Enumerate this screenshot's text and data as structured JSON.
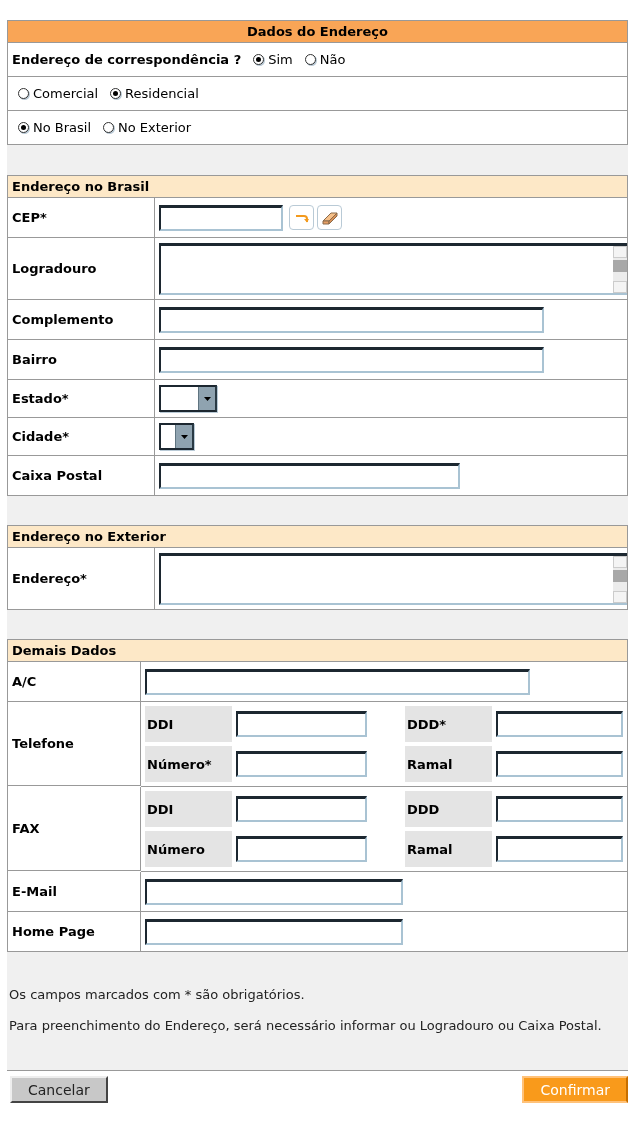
{
  "title": "Dados do Endereço",
  "correspondence": {
    "label": "Endereço de correspondência ?",
    "options": [
      {
        "label": "Sim",
        "selected": true
      },
      {
        "label": "Não",
        "selected": false
      }
    ]
  },
  "address_type": {
    "options": [
      {
        "label": "Comercial",
        "selected": false
      },
      {
        "label": "Residencial",
        "selected": true
      }
    ]
  },
  "location": {
    "options": [
      {
        "label": "No Brasil",
        "selected": true
      },
      {
        "label": "No Exterior",
        "selected": false
      }
    ]
  },
  "sections": [
    {
      "title": "Endereço no Brasil",
      "fields": [
        {
          "label": "CEP*",
          "kind": "cep"
        },
        {
          "label": "Logradouro",
          "kind": "area"
        },
        {
          "label": "Complemento",
          "kind": "long"
        },
        {
          "label": "Bairro",
          "kind": "long"
        },
        {
          "label": "Estado*",
          "kind": "select"
        },
        {
          "label": "Cidade*",
          "kind": "select"
        },
        {
          "label": "Caixa Postal",
          "kind": "short"
        }
      ]
    },
    {
      "title": "Endereço no Exterior",
      "fields": [
        {
          "label": "Endereço*",
          "kind": "area"
        }
      ]
    },
    {
      "title": "Demais Dados",
      "fields": [
        {
          "label": "A/C",
          "kind": "long"
        },
        {
          "label": "Telefone",
          "kind": "phone",
          "parts": [
            "DDI",
            "DDD*",
            "Número*",
            "Ramal"
          ]
        },
        {
          "label": "FAX",
          "kind": "phone",
          "parts": [
            "DDI",
            "DDD",
            "Número",
            "Ramal"
          ]
        },
        {
          "label": "E-Mail",
          "kind": "short"
        },
        {
          "label": "Home Page",
          "kind": "short"
        }
      ]
    }
  ],
  "notes": [
    "Os campos marcados com * são obrigatórios.",
    "Para preenchimento do Endereço, será necessário informar ou Logradouro ou Caixa Postal."
  ],
  "buttons": [
    {
      "label": "Cancelar",
      "kind": "secondary"
    },
    {
      "label": "Confirmar",
      "kind": "primary"
    }
  ]
}
